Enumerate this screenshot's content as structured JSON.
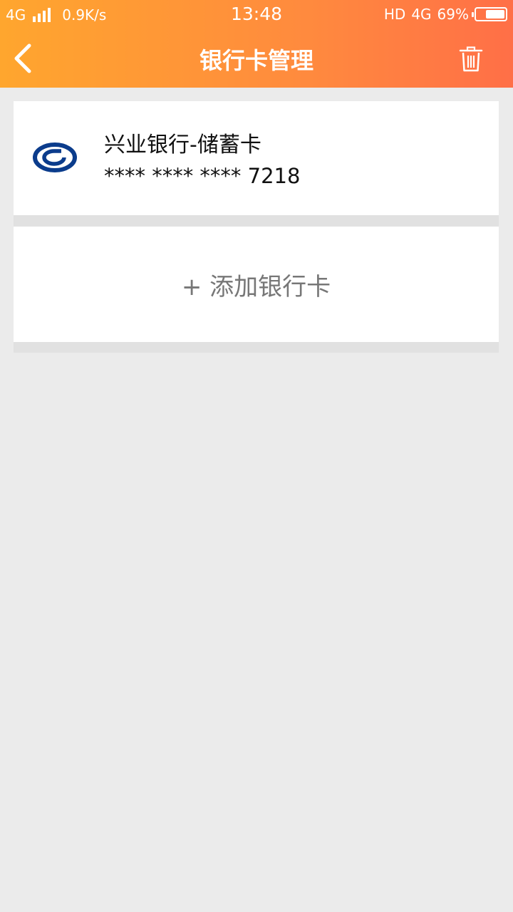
{
  "status_bar": {
    "network": "4G",
    "speed": "0.9K/s",
    "time": "13:48",
    "hd": "HD",
    "network_right": "4G",
    "battery": "69%",
    "battery_level": 0.69
  },
  "header": {
    "title": "银行卡管理",
    "back_icon": "chevron-left-icon",
    "delete_icon": "trash-icon"
  },
  "cards": [
    {
      "bank_name": "兴业银行-储蓄卡",
      "number": "**** **** **** 7218",
      "logo_icon": "bank-logo-icon"
    }
  ],
  "add_card": {
    "label": "+ 添加银行卡"
  },
  "colors": {
    "header_start": "#ffa62e",
    "header_end": "#ff6f47",
    "background": "#ebebeb",
    "logo_blue": "#0b3c8c"
  }
}
